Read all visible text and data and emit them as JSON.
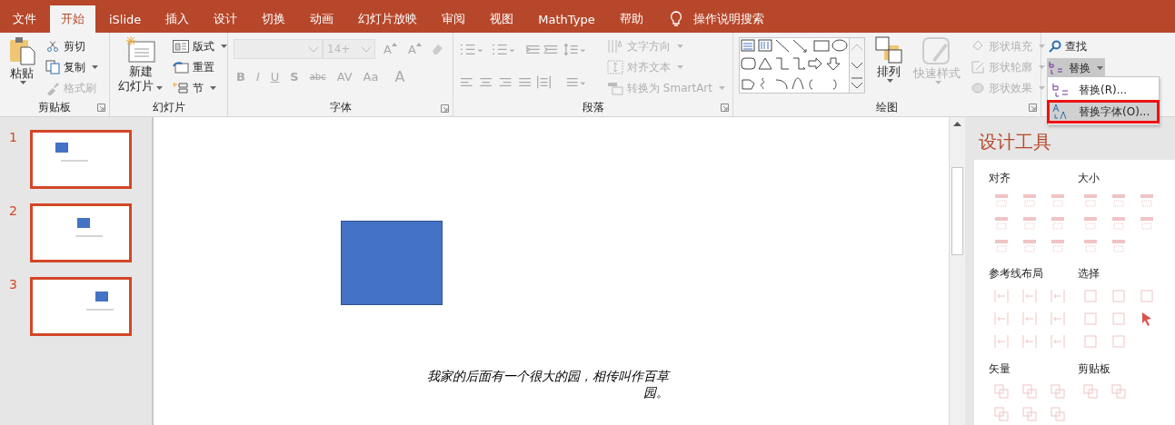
{
  "tabs": [
    {
      "label": "文件",
      "selected": false
    },
    {
      "label": "开始",
      "selected": true
    },
    {
      "label": "iSlide",
      "selected": false
    },
    {
      "label": "插入",
      "selected": false
    },
    {
      "label": "设计",
      "selected": false
    },
    {
      "label": "切换",
      "selected": false
    },
    {
      "label": "动画",
      "selected": false
    },
    {
      "label": "幻灯片放映",
      "selected": false
    },
    {
      "label": "审阅",
      "selected": false
    },
    {
      "label": "视图",
      "selected": false
    },
    {
      "label": "MathType",
      "selected": false
    },
    {
      "label": "帮助",
      "selected": false
    }
  ],
  "tell_me": {
    "label": "操作说明搜索"
  },
  "clipboard": {
    "paste": "粘贴",
    "cut": {
      "label": "剪切",
      "disabled": false
    },
    "copy": {
      "label": "复制",
      "disabled": false
    },
    "format_painter": {
      "label": "格式刷",
      "disabled": true
    },
    "group_label": "剪贴板"
  },
  "slides_group": {
    "new_slide": [
      "新建",
      "幻灯片"
    ],
    "layout": "版式",
    "reset": "重置",
    "section": "节",
    "group_label": "幻灯片"
  },
  "font": {
    "size": "14+",
    "grow": "A",
    "shrink": "A",
    "styles": [
      "B",
      "I",
      "U",
      "S",
      "abc",
      "AV",
      "Aa"
    ],
    "font_color_label": "A",
    "group_label": "字体"
  },
  "paragraph": {
    "text_direction": "文字方向",
    "align_text": "对齐文本",
    "smartart": "转换为 SmartArt",
    "group_label": "段落"
  },
  "drawing": {
    "arrange": "排列",
    "quick_styles": {
      "label": "快速样式",
      "disabled": true
    },
    "commands": [
      {
        "label": "形状填充",
        "disabled": true
      },
      {
        "label": "形状轮廓",
        "disabled": true
      },
      {
        "label": "形状效果",
        "disabled": true
      }
    ],
    "group_label": "绘图"
  },
  "editing": {
    "find": "查找",
    "replace": {
      "label": "替换",
      "expanded": true
    }
  },
  "replace_menu": {
    "items": [
      {
        "label": "替换(R)...",
        "selected": false
      },
      {
        "label": "替换字体(O)...",
        "selected": true
      }
    ]
  },
  "slides": [
    {
      "number": "1"
    },
    {
      "number": "2"
    },
    {
      "number": "3"
    }
  ],
  "canvas": {
    "text": "我家的后面有一个很大的园，相传叫作百草园。"
  },
  "design_pane": {
    "title": "设计工具",
    "sections": [
      {
        "label": "对齐",
        "kind": "align"
      },
      {
        "label": "大小",
        "kind": "size"
      },
      {
        "label": "参考线布局",
        "kind": "guides"
      },
      {
        "label": "选择",
        "kind": "select"
      },
      {
        "label": "矢量",
        "kind": "vector"
      },
      {
        "label": "剪贴板",
        "kind": "clipboard"
      }
    ]
  }
}
